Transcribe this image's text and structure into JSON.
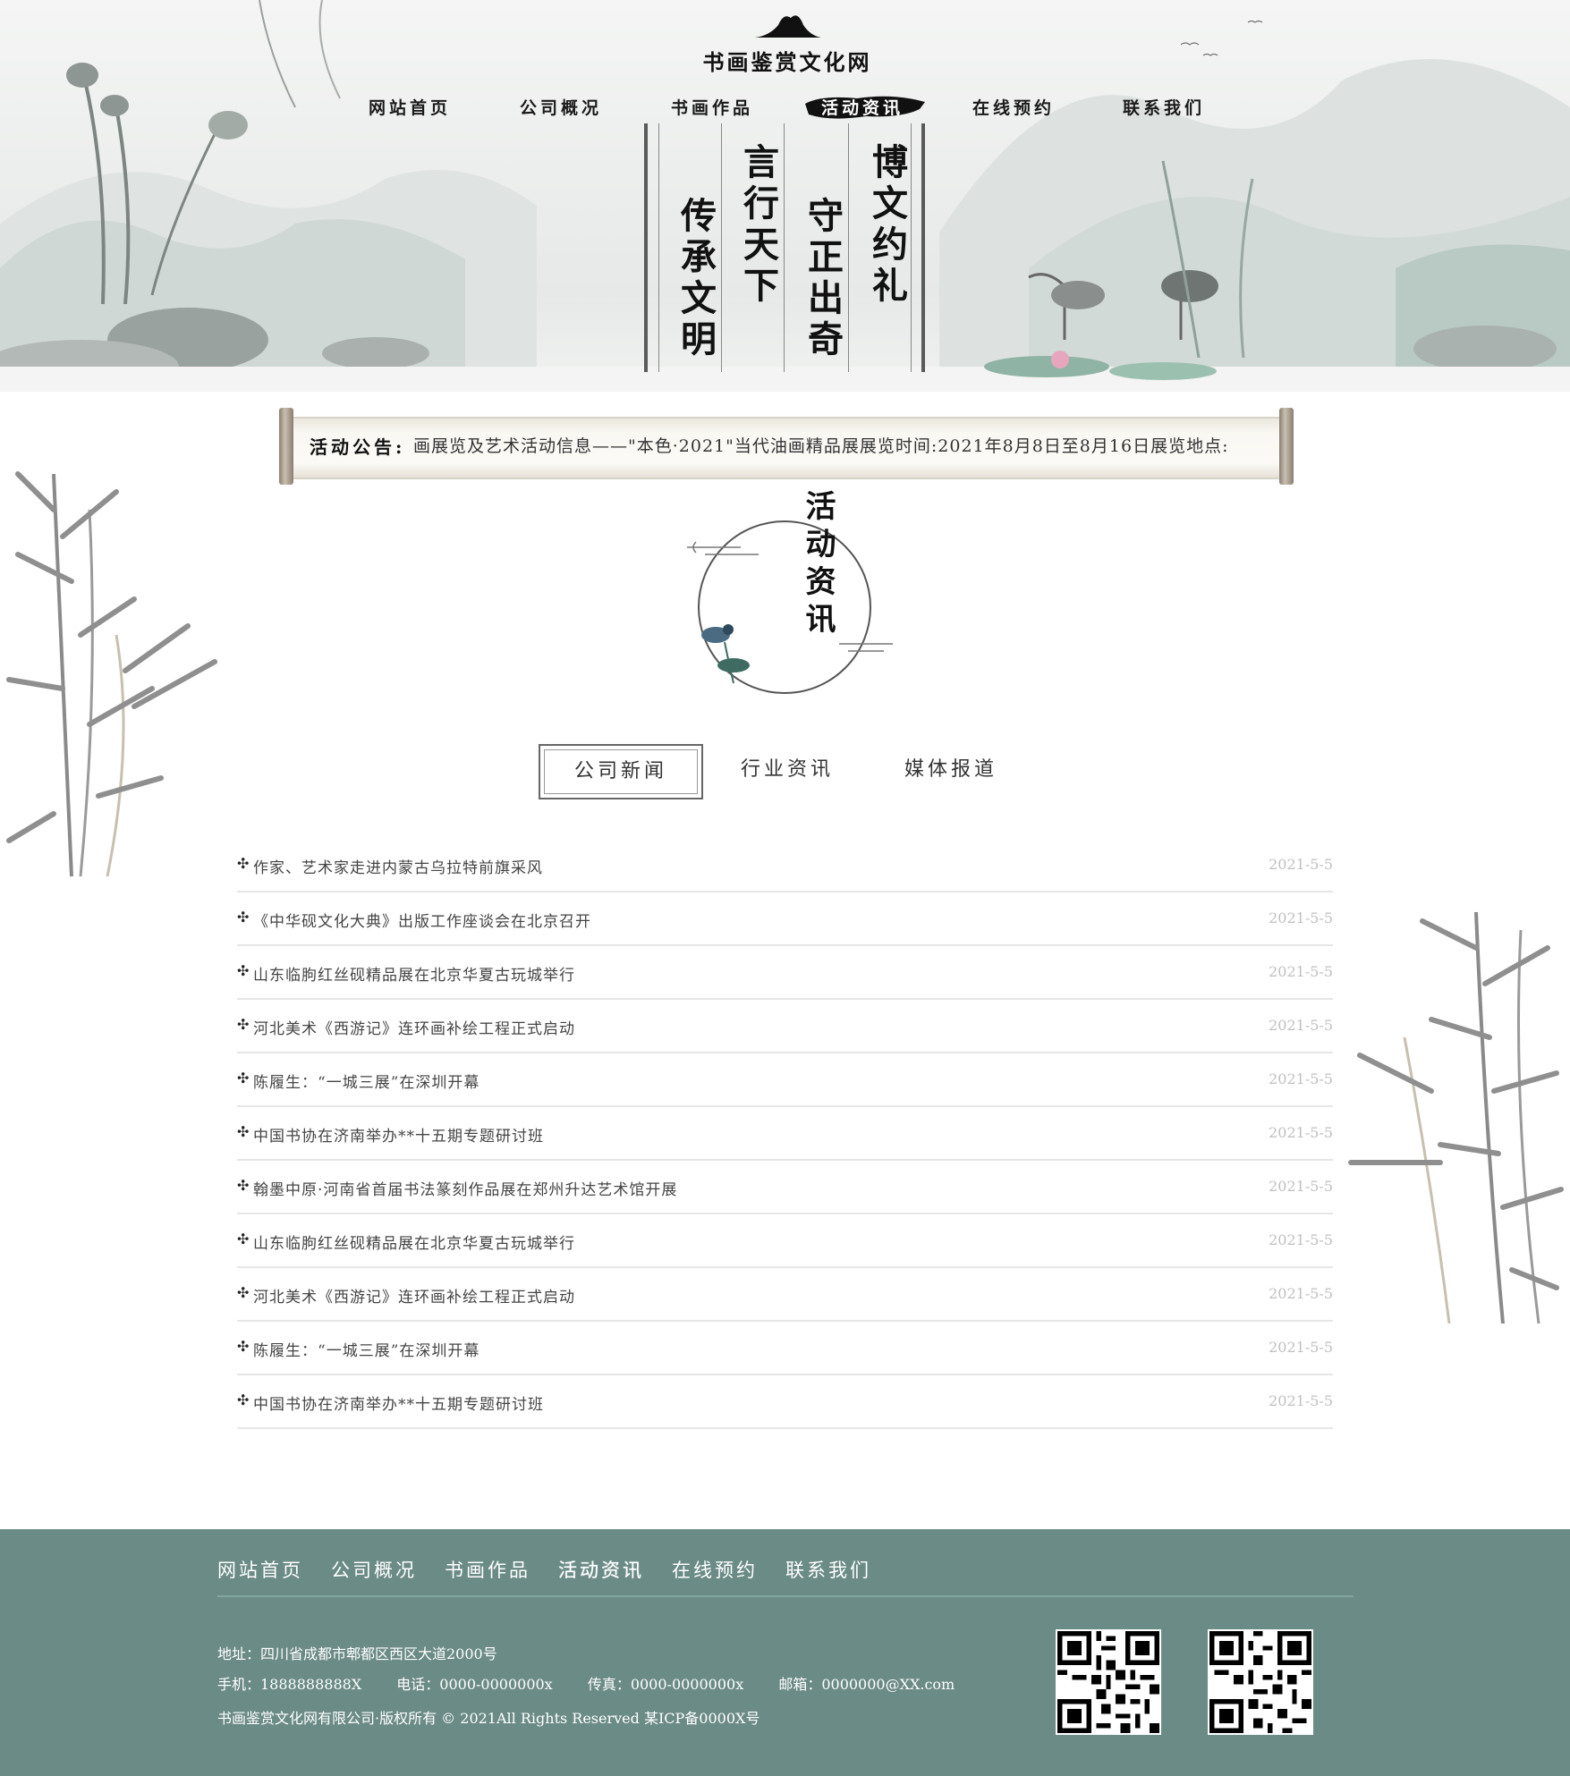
{
  "site": {
    "title": "书画鉴赏文化网"
  },
  "nav": {
    "items": [
      {
        "label": "网站首页"
      },
      {
        "label": "公司概况"
      },
      {
        "label": "书画作品"
      },
      {
        "label": "活动资讯"
      },
      {
        "label": "在线预约"
      },
      {
        "label": "联系我们"
      }
    ],
    "active_index": 3
  },
  "mottos": [
    "传承文明",
    "言行天下",
    "守正出奇",
    "博文约礼"
  ],
  "notice": {
    "label": "活动公告:",
    "text": "画展览及艺术活动信息——\"本色·2021\"当代油画精品展展览时间:2021年8月8日至8月16日展览地点:"
  },
  "section": {
    "heading": "活动资讯"
  },
  "tabs": [
    {
      "label": "公司新闻"
    },
    {
      "label": "行业资讯"
    },
    {
      "label": "媒体报道"
    }
  ],
  "active_tab": 0,
  "news": {
    "bullet": "✣",
    "items": [
      {
        "title": "作家、艺术家走进内蒙古乌拉特前旗采风",
        "date": "2021-5-5"
      },
      {
        "title": "《中华砚文化大典》出版工作座谈会在北京召开",
        "date": "2021-5-5"
      },
      {
        "title": "山东临朐红丝砚精品展在北京华夏古玩城举行",
        "date": "2021-5-5"
      },
      {
        "title": "河北美术《西游记》连环画补绘工程正式启动",
        "date": "2021-5-5"
      },
      {
        "title": "陈履生：“一城三展”在深圳开幕",
        "date": "2021-5-5"
      },
      {
        "title": "中国书协在济南举办**十五期专题研讨班",
        "date": "2021-5-5"
      },
      {
        "title": "翰墨中原·河南省首届书法篆刻作品展在郑州升达艺术馆开展",
        "date": "2021-5-5"
      },
      {
        "title": "山东临朐红丝砚精品展在北京华夏古玩城举行",
        "date": "2021-5-5"
      },
      {
        "title": "河北美术《西游记》连环画补绘工程正式启动",
        "date": "2021-5-5"
      },
      {
        "title": "陈履生：“一城三展”在深圳开幕",
        "date": "2021-5-5"
      },
      {
        "title": "中国书协在济南举办**十五期专题研讨班",
        "date": "2021-5-5"
      }
    ]
  },
  "footer": {
    "nav": [
      "网站首页",
      "公司概况",
      "书画作品",
      "活动资讯",
      "在线预约",
      "联系我们"
    ],
    "active_index": 3,
    "address": "地址：四川省成都市郫都区西区大道2000号",
    "mobile": "手机：1888888888X",
    "phone": "电话：0000-0000000x",
    "fax": "传真：0000-0000000x",
    "email": "邮箱：0000000@XX.com",
    "copyright": "书画鉴赏文化网有限公司·版权所有 © 2021All Rights Reserved 某ICP备0000X号"
  },
  "colors": {
    "footer_bg": "#6b8b86",
    "date_text": "#c0c0c0",
    "divider": "#7fa8a0"
  }
}
